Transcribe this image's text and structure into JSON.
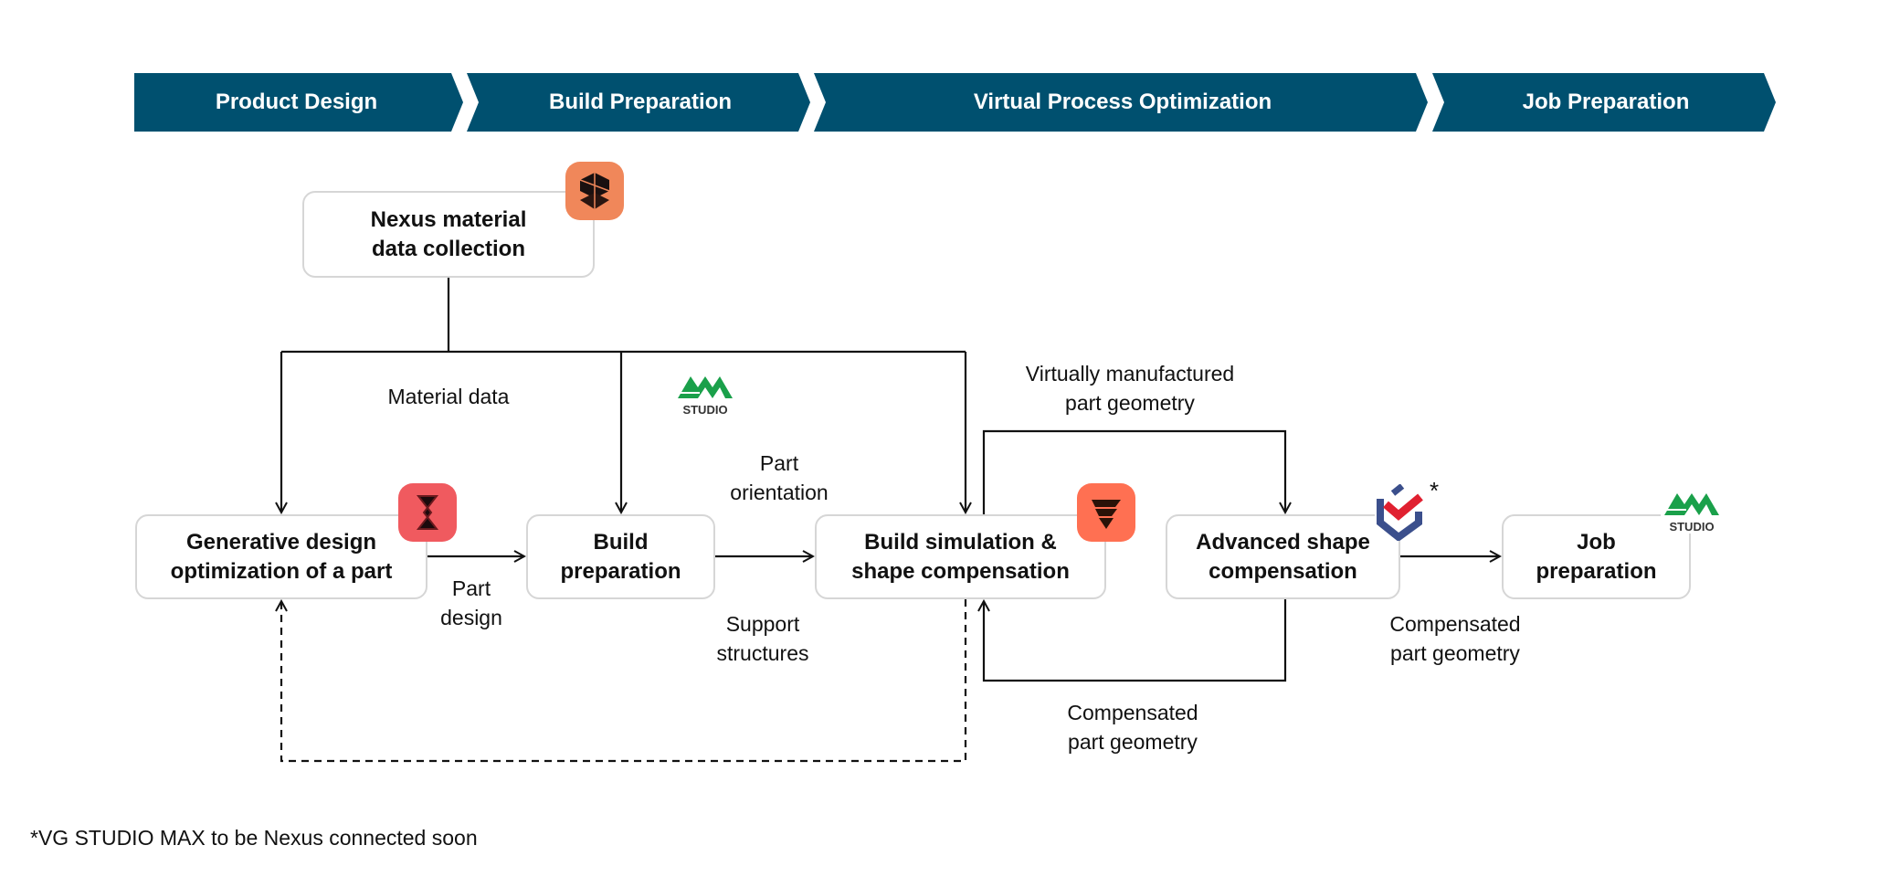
{
  "phases": [
    {
      "label": "Product Design"
    },
    {
      "label": "Build Preparation"
    },
    {
      "label": "Virtual Process Optimization"
    },
    {
      "label": "Job Preparation"
    }
  ],
  "colors": {
    "phase_bar": "#00506f",
    "nexus_icon": "#f0875a",
    "gen_icon": "#f05a5f",
    "sim_icon": "#ff7052",
    "am_green": "#1aa04a",
    "vg_red": "#e02030",
    "vg_blue": "#3b4f8c"
  },
  "nodes": {
    "nexus": {
      "line1": "Nexus material",
      "line2": "data collection",
      "icon": "nexus-cube-icon"
    },
    "generative": {
      "line1": "Generative design",
      "line2": "optimization of a part",
      "icon": "generative-design-icon"
    },
    "build_prep": {
      "line1": "Build",
      "line2": "preparation"
    },
    "build_sim": {
      "line1": "Build simulation &",
      "line2": "shape compensation",
      "icon": "simulation-icon"
    },
    "advanced": {
      "line1": "Advanced shape",
      "line2": "compensation",
      "icon": "vgstudio-icon",
      "mark": "*"
    },
    "job": {
      "line1": "Job",
      "line2": "preparation"
    }
  },
  "am_studio": {
    "word": "STUDIO",
    "mark": "AM"
  },
  "edge_labels": {
    "material": "Material data",
    "part_design": [
      "Part",
      "design"
    ],
    "part_orientation": [
      "Part",
      "orientation"
    ],
    "support": [
      "Support",
      "structures"
    ],
    "virtual": [
      "Virtually manufactured",
      "part geometry"
    ],
    "comp_back": [
      "Compensated",
      "part geometry"
    ],
    "comp_fwd": [
      "Compensated",
      "part geometry"
    ]
  },
  "footnote": "*VG STUDIO MAX to be Nexus connected soon"
}
